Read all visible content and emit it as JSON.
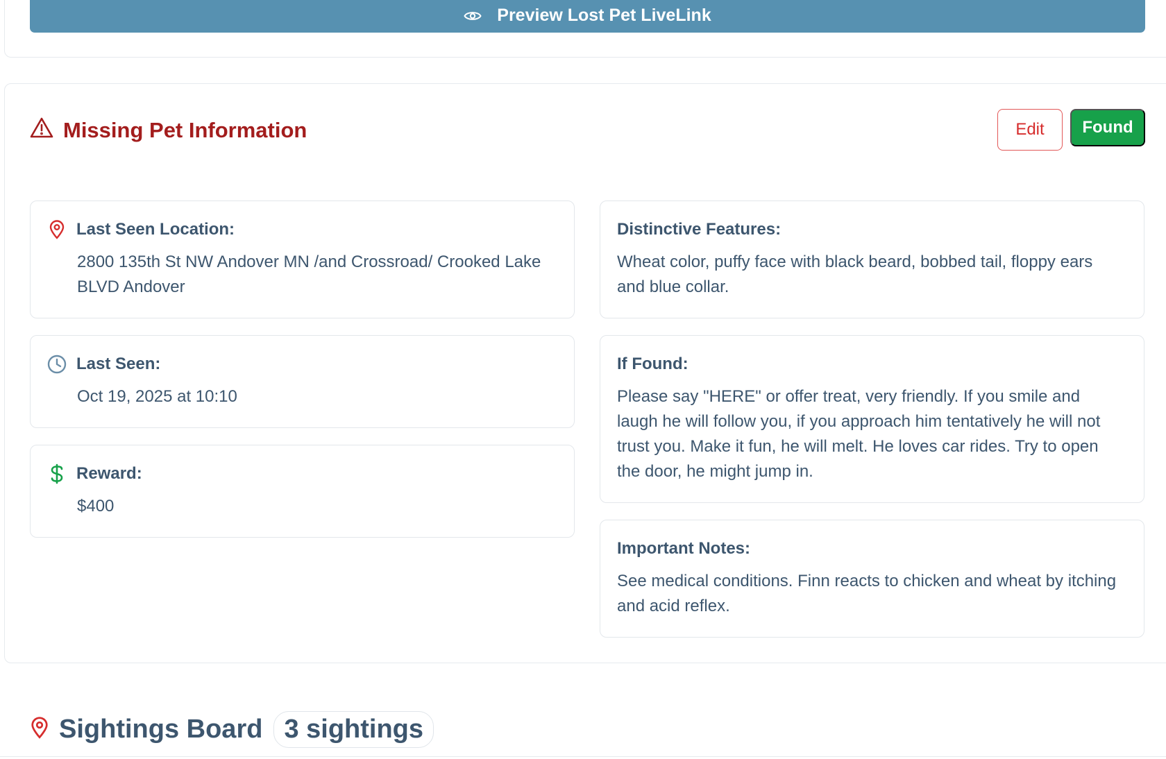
{
  "preview_button": {
    "label": "Preview Lost Pet LiveLink",
    "icon": "eye-icon"
  },
  "missing_info": {
    "title": "Missing Pet Information",
    "icon": "warning-triangle-icon",
    "edit_label": "Edit",
    "found_label": "Found",
    "colors": {
      "title": "#a31d1d",
      "found": "#17a14a",
      "edit_border": "#e25757",
      "preview": "#5791b1"
    }
  },
  "last_seen_location": {
    "label": "Last Seen Location:",
    "value": "2800 135th St NW Andover MN /and Crossroad/ Crooked Lake BLVD Andover",
    "icon": "map-pin-icon"
  },
  "last_seen": {
    "label": "Last Seen:",
    "value": "Oct 19, 2025 at 10:10",
    "icon": "clock-icon"
  },
  "reward": {
    "label": "Reward:",
    "value": "$400",
    "icon": "dollar-icon"
  },
  "distinctive_features": {
    "label": "Distinctive Features:",
    "value": "Wheat color, puffy face with black beard, bobbed tail, floppy ears and blue collar."
  },
  "if_found": {
    "label": "If Found:",
    "value": "Please say \"HERE\" or offer treat, very friendly. If you smile and laugh he will follow you, if you approach him tentatively he will not trust you. Make it fun, he will melt. He loves car rides. Try to open the door, he might jump in."
  },
  "important_notes": {
    "label": "Important Notes:",
    "value": "See medical conditions. Finn reacts to chicken and wheat by itching and acid reflex."
  },
  "sightings_board": {
    "title": "Sightings Board",
    "count_badge": "3 sightings",
    "icon": "map-pin-icon"
  }
}
